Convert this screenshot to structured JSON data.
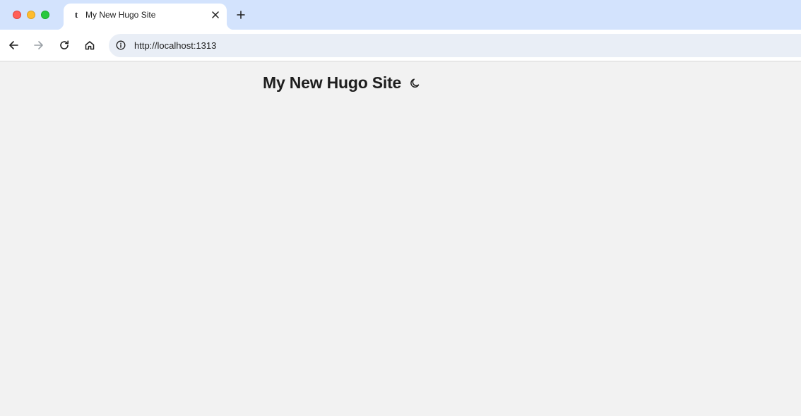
{
  "browser": {
    "tab": {
      "favicon_letter": "t",
      "title": "My New Hugo Site",
      "close_icon": "close-icon"
    },
    "new_tab_icon": "plus-icon",
    "nav": {
      "back_icon": "arrow-left-icon",
      "forward_icon": "arrow-right-icon",
      "reload_icon": "reload-icon",
      "home_icon": "home-icon"
    },
    "address_bar": {
      "site_info_icon": "info-icon",
      "url": "http://localhost:1313"
    }
  },
  "page": {
    "site_title": "My New Hugo Site",
    "theme_toggle_icon": "moon-icon"
  },
  "colors": {
    "tabstrip": "#d3e3fd",
    "omnibox": "#e9eef6",
    "page_background": "#f2f2f2"
  }
}
